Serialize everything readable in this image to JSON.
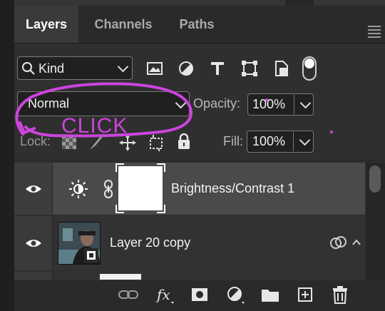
{
  "tabs": [
    {
      "label": "Layers",
      "active": true
    },
    {
      "label": "Channels",
      "active": false
    },
    {
      "label": "Paths",
      "active": false
    }
  ],
  "filter": {
    "kind_label": "Kind"
  },
  "blend": {
    "mode": "Normal"
  },
  "opacity": {
    "label": "Opacity:",
    "value": "100%"
  },
  "lock": {
    "label": "Lock:"
  },
  "fill": {
    "label": "Fill:",
    "value": "100%"
  },
  "layers": [
    {
      "name": "Brightness/Contrast 1",
      "selected": true
    },
    {
      "name": "Layer 20 copy",
      "selected": false
    }
  ],
  "annotation": {
    "text": "CLICK",
    "color": "#cc44dd"
  },
  "colors": {
    "panel": "#2f2f2f",
    "selected_row": "#4a4a4a",
    "accent": "#cc44dd"
  },
  "icons": [
    "search-icon",
    "image-filter-icon",
    "adjustment-filter-icon",
    "type-filter-icon",
    "shape-filter-icon",
    "smart-object-filter-icon",
    "filter-toggle",
    "eye-icon",
    "link-icon",
    "fx-icon",
    "mask-icon",
    "new-group-icon",
    "new-layer-icon",
    "trash-icon"
  ]
}
